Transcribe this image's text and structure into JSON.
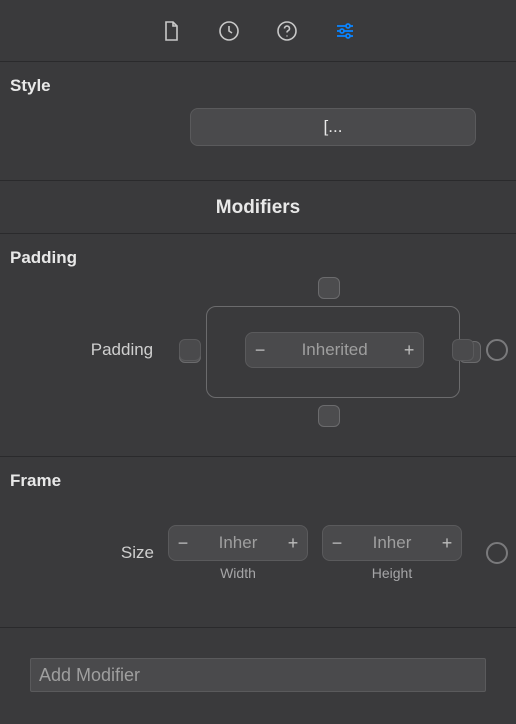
{
  "tabs": [
    "file",
    "history",
    "help",
    "attributes"
  ],
  "active_tab": 3,
  "style": {
    "header": "Style",
    "dropdown_value": "[..."
  },
  "modifiers": {
    "title": "Modifiers"
  },
  "padding": {
    "header": "Padding",
    "label": "Padding",
    "value": "Inherited",
    "minus": "−",
    "plus": "+"
  },
  "frame": {
    "header": "Frame",
    "size_label": "Size",
    "width_label": "Width",
    "height_label": "Height",
    "width_value": "Inher",
    "height_value": "Inher",
    "minus": "−",
    "plus": "+"
  },
  "add_modifier": {
    "placeholder": "Add Modifier"
  }
}
